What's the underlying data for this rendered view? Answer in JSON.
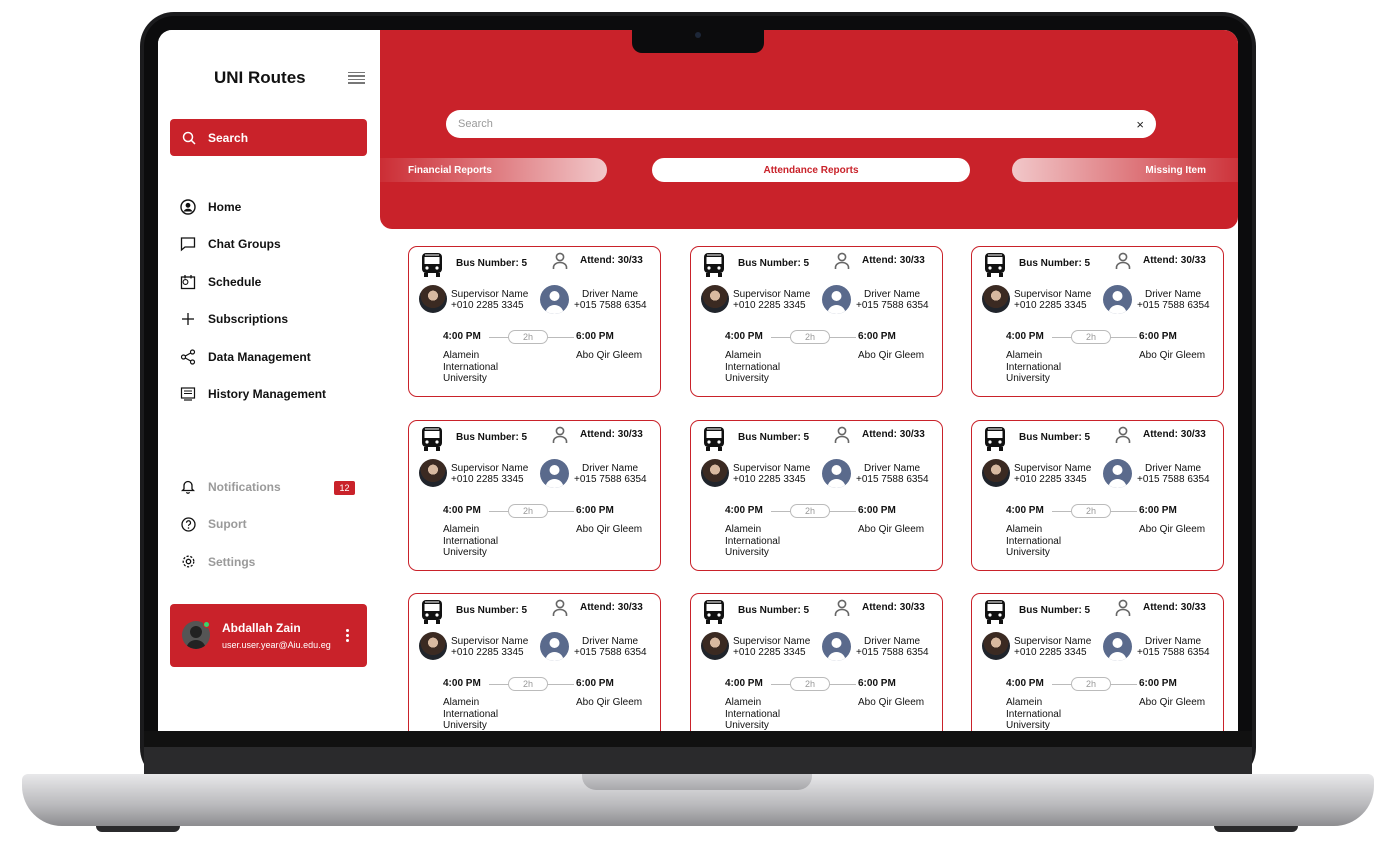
{
  "sidebar": {
    "brand": "UNI Routes",
    "search_label": "Search",
    "nav": [
      {
        "label": "Home",
        "icon": "user-circle-icon"
      },
      {
        "label": "Chat Groups",
        "icon": "chat-icon"
      },
      {
        "label": "Schedule",
        "icon": "schedule-icon"
      },
      {
        "label": "Subscriptions",
        "icon": "plus-icon"
      },
      {
        "label": "Data Management",
        "icon": "share-icon"
      },
      {
        "label": "History Management",
        "icon": "history-icon"
      }
    ],
    "nav_bottom": [
      {
        "label": "Notifications",
        "icon": "bell-icon"
      },
      {
        "label": "Suport",
        "icon": "help-icon"
      },
      {
        "label": "Settings",
        "icon": "gear-icon"
      }
    ],
    "notifications_count": "12",
    "user": {
      "name": "Abdallah Zain",
      "email": "user.user.year@Aiu.edu.eg"
    }
  },
  "header": {
    "search_placeholder": "Search",
    "clear_icon": "×",
    "tabs": {
      "financial": "Financial Reports",
      "attendance": "Attendance Reports",
      "missing": "Missing Item"
    }
  },
  "accent_color": "#c9222a",
  "cards": [
    {
      "bus": "Bus Number: 5",
      "attend": "Attend: 30/33",
      "supervisor": "Supervisor Name",
      "sup_phone": "+010 2285 3345",
      "driver": "Driver Name",
      "drv_phone": "+015 7588 6354",
      "dep": "4:00 PM",
      "dur": "2h",
      "arr": "6:00 PM",
      "from": "Alamein International University",
      "to": "Abo Qir Gleem"
    },
    {
      "bus": "Bus Number: 5",
      "attend": "Attend: 30/33",
      "supervisor": "Supervisor Name",
      "sup_phone": "+010 2285 3345",
      "driver": "Driver Name",
      "drv_phone": "+015 7588 6354",
      "dep": "4:00 PM",
      "dur": "2h",
      "arr": "6:00 PM",
      "from": "Alamein International University",
      "to": "Abo Qir Gleem"
    },
    {
      "bus": "Bus Number: 5",
      "attend": "Attend: 30/33",
      "supervisor": "Supervisor Name",
      "sup_phone": "+010 2285 3345",
      "driver": "Driver Name",
      "drv_phone": "+015 7588 6354",
      "dep": "4:00 PM",
      "dur": "2h",
      "arr": "6:00 PM",
      "from": "Alamein International University",
      "to": "Abo Qir Gleem"
    },
    {
      "bus": "Bus Number: 5",
      "attend": "Attend: 30/33",
      "supervisor": "Supervisor Name",
      "sup_phone": "+010 2285 3345",
      "driver": "Driver Name",
      "drv_phone": "+015 7588 6354",
      "dep": "4:00 PM",
      "dur": "2h",
      "arr": "6:00 PM",
      "from": "Alamein International University",
      "to": "Abo Qir Gleem"
    },
    {
      "bus": "Bus Number: 5",
      "attend": "Attend: 30/33",
      "supervisor": "Supervisor Name",
      "sup_phone": "+010 2285 3345",
      "driver": "Driver Name",
      "drv_phone": "+015 7588 6354",
      "dep": "4:00 PM",
      "dur": "2h",
      "arr": "6:00 PM",
      "from": "Alamein International University",
      "to": "Abo Qir Gleem"
    },
    {
      "bus": "Bus Number: 5",
      "attend": "Attend: 30/33",
      "supervisor": "Supervisor Name",
      "sup_phone": "+010 2285 3345",
      "driver": "Driver Name",
      "drv_phone": "+015 7588 6354",
      "dep": "4:00 PM",
      "dur": "2h",
      "arr": "6:00 PM",
      "from": "Alamein International University",
      "to": "Abo Qir Gleem"
    },
    {
      "bus": "Bus Number: 5",
      "attend": "Attend: 30/33",
      "supervisor": "Supervisor Name",
      "sup_phone": "+010 2285 3345",
      "driver": "Driver Name",
      "drv_phone": "+015 7588 6354",
      "dep": "4:00 PM",
      "dur": "2h",
      "arr": "6:00 PM",
      "from": "Alamein International University",
      "to": "Abo Qir Gleem"
    },
    {
      "bus": "Bus Number: 5",
      "attend": "Attend: 30/33",
      "supervisor": "Supervisor Name",
      "sup_phone": "+010 2285 3345",
      "driver": "Driver Name",
      "drv_phone": "+015 7588 6354",
      "dep": "4:00 PM",
      "dur": "2h",
      "arr": "6:00 PM",
      "from": "Alamein International University",
      "to": "Abo Qir Gleem"
    },
    {
      "bus": "Bus Number: 5",
      "attend": "Attend: 30/33",
      "supervisor": "Supervisor Name",
      "sup_phone": "+010 2285 3345",
      "driver": "Driver Name",
      "drv_phone": "+015 7588 6354",
      "dep": "4:00 PM",
      "dur": "2h",
      "arr": "6:00 PM",
      "from": "Alamein International University",
      "to": "Abo Qir Gleem"
    }
  ]
}
